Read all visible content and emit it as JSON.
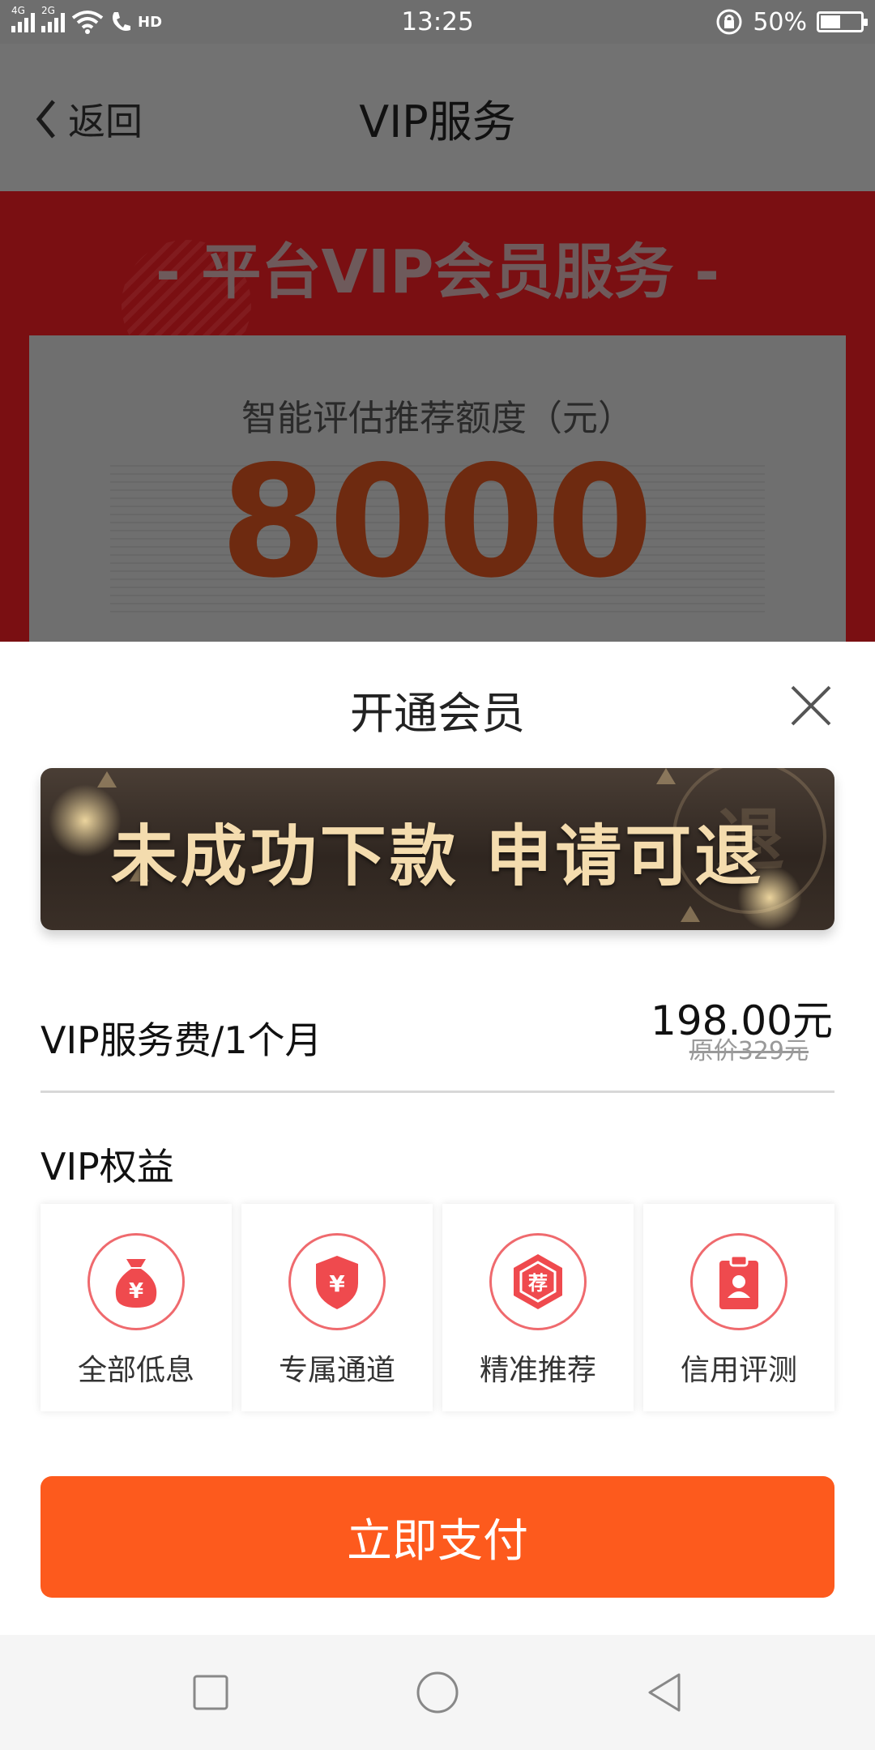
{
  "status_bar": {
    "network_1": "4G",
    "network_2": "2G",
    "hd": "HD",
    "time": "13:25",
    "battery_percent": "50%",
    "battery_level": 0.5
  },
  "header": {
    "back_label": "返回",
    "title": "VIP服务"
  },
  "hero": {
    "title": "- 平台VIP会员服务 -",
    "quota_label": "智能评估推荐额度（元）",
    "quota_value": "8000"
  },
  "sheet": {
    "title": "开通会员",
    "banner_text": "未成功下款 申请可退",
    "banner_watermark": "退",
    "fee_label": "VIP服务费/1个月",
    "fee_price": "198.00元",
    "fee_original": "原价329元",
    "benefits_title": "VIP权益",
    "benefits": [
      {
        "label": "全部低息",
        "icon": "money-bag-icon"
      },
      {
        "label": "专属通道",
        "icon": "shield-yen-icon"
      },
      {
        "label": "精准推荐",
        "icon": "recommend-hexagon-icon"
      },
      {
        "label": "信用评测",
        "icon": "clipboard-user-icon"
      }
    ],
    "benefit_icon_glyphs": [
      "¥",
      "¥",
      "荐",
      ""
    ],
    "pay_button": "立即支付"
  },
  "colors": {
    "accent": "#fd5a1d",
    "icon_red": "#ef4a4e",
    "banner_text": "#f4dcae"
  }
}
